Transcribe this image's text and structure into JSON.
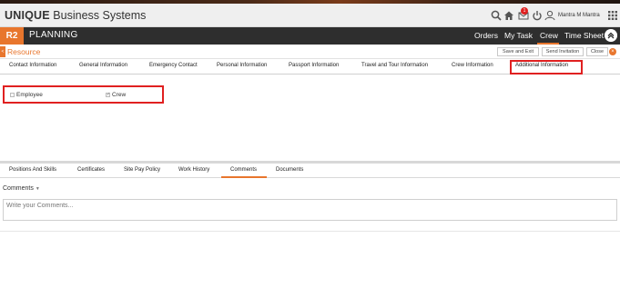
{
  "brand": {
    "bold": "UNIQUE",
    "rest": " Business Systems"
  },
  "header": {
    "badge_count": "1",
    "username": "Mantra M Mantra",
    "icons": [
      "search-icon",
      "home-icon",
      "mail-icon",
      "power-icon",
      "user-icon",
      "grid-icon"
    ]
  },
  "nav": {
    "app_code": "R2",
    "module": "PLANNING",
    "links": [
      "Orders",
      "My Task",
      "Crew",
      "Time Sheet"
    ],
    "active": "Crew"
  },
  "section": {
    "side_tab": "<",
    "title": "Resource",
    "buttons": [
      "Save and Exit",
      "Send Invitation",
      "Close"
    ]
  },
  "tabs": [
    "Contact Information",
    "General Information",
    "Emergency Contact",
    "Personal Information",
    "Passport Information",
    "Travel and Tour Information",
    "Crew Information",
    "Additional Information"
  ],
  "active_tab": "Additional Information",
  "checks": [
    {
      "label": "Employee",
      "checked": false
    },
    {
      "label": "Crew",
      "checked": true
    }
  ],
  "bottom_tabs": [
    "Positions And Skills",
    "Certificates",
    "Site Pay Policy",
    "Work History",
    "Comments",
    "Documents"
  ],
  "bottom_active": "Comments",
  "comments": {
    "label": "Comments",
    "placeholder": "Write your Comments..."
  },
  "colors": {
    "accent": "#e8762d",
    "highlight": "#e02020",
    "nav_bg": "#2e2e2e"
  }
}
